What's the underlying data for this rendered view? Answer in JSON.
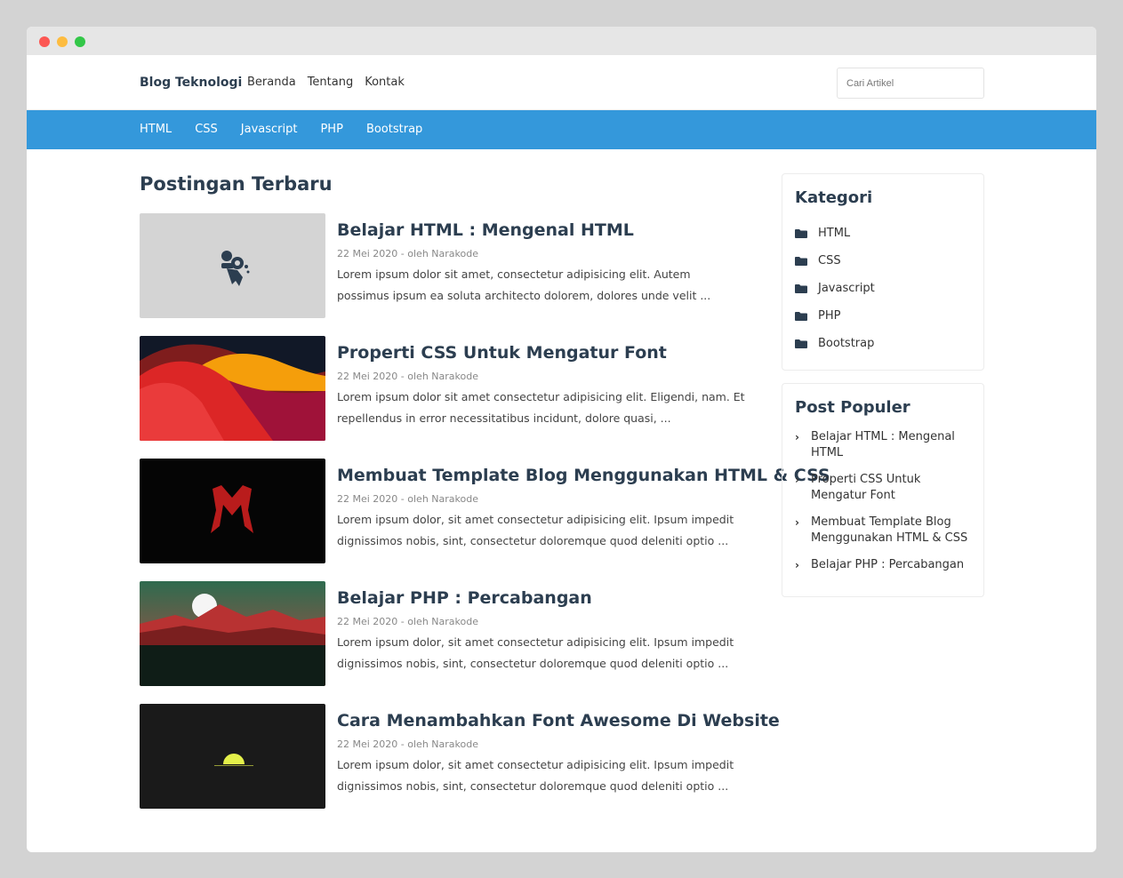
{
  "header": {
    "brand": "Blog Teknologi",
    "nav": [
      "Beranda",
      "Tentang",
      "Kontak"
    ],
    "search_placeholder": "Cari Artikel"
  },
  "category_nav": [
    "HTML",
    "CSS",
    "Javascript",
    "PHP",
    "Bootstrap"
  ],
  "main": {
    "title": "Postingan Terbaru",
    "posts": [
      {
        "title": "Belajar HTML : Mengenal HTML",
        "meta": "22 Mei 2020 - oleh Narakode",
        "excerpt": "Lorem ipsum dolor sit amet, consectetur adipisicing elit. Autem possimus ipsum ea soluta architecto dolorem, dolores unde velit ..."
      },
      {
        "title": "Properti CSS Untuk Mengatur Font",
        "meta": "22 Mei 2020 - oleh Narakode",
        "excerpt": "Lorem ipsum dolor sit amet consectetur adipisicing elit. Eligendi, nam. Et repellendus in error necessitatibus incidunt, dolore quasi, ..."
      },
      {
        "title": "Membuat Template Blog Menggunakan HTML & CSS",
        "meta": "22 Mei 2020 - oleh Narakode",
        "excerpt": "Lorem ipsum dolor, sit amet consectetur adipisicing elit. Ipsum impedit dignissimos nobis, sint, consectetur doloremque quod deleniti optio ..."
      },
      {
        "title": "Belajar PHP : Percabangan",
        "meta": "22 Mei 2020 - oleh Narakode",
        "excerpt": "Lorem ipsum dolor, sit amet consectetur adipisicing elit. Ipsum impedit dignissimos nobis, sint, consectetur doloremque quod deleniti optio ..."
      },
      {
        "title": "Cara Menambahkan Font Awesome Di Website",
        "meta": "22 Mei 2020 - oleh Narakode",
        "excerpt": "Lorem ipsum dolor, sit amet consectetur adipisicing elit. Ipsum impedit dignissimos nobis, sint, consectetur doloremque quod deleniti optio ..."
      }
    ]
  },
  "sidebar": {
    "categories_title": "Kategori",
    "categories": [
      "HTML",
      "CSS",
      "Javascript",
      "PHP",
      "Bootstrap"
    ],
    "popular_title": "Post Populer",
    "popular": [
      "Belajar HTML : Mengenal HTML",
      "Properti CSS Untuk Mengatur Font",
      "Membuat Template Blog Menggunakan HTML & CSS",
      "Belajar PHP : Percabangan"
    ]
  },
  "colors": {
    "accent": "#3498db",
    "heading": "#2c3e50"
  },
  "icons": {
    "category": "folder-icon",
    "popular": "chevron-right-icon"
  }
}
